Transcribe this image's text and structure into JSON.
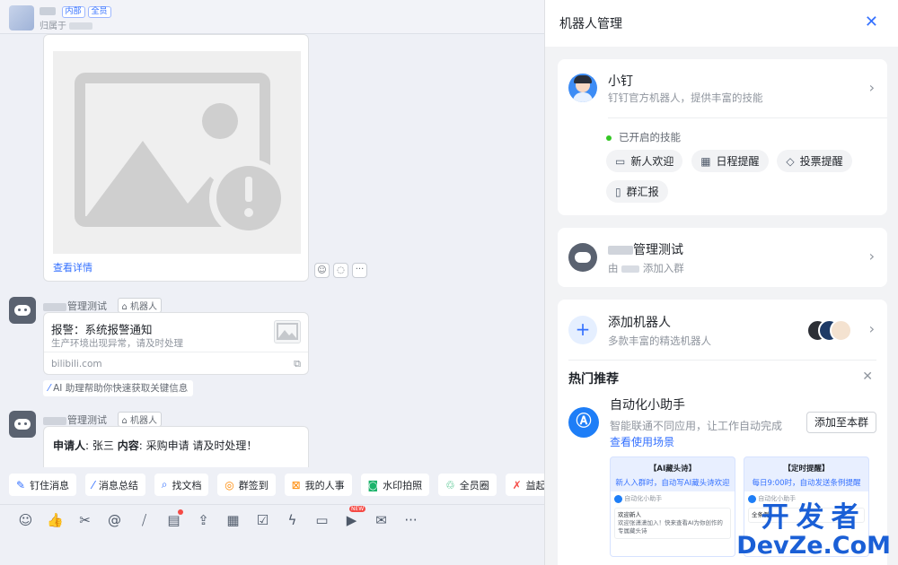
{
  "chat": {
    "header_tag1": "内部",
    "header_tag2": "全员",
    "header_sub": "归属于",
    "img_card": {
      "link": "查看详情"
    },
    "msg1": {
      "name_suffix": "管理测试",
      "robot_tag": "机器人",
      "title": "报警：系统报警通知",
      "desc": "生产环境出现异常，请及时处理",
      "source": "bilibili.com",
      "ai_hint": "AI 助理帮助你快速获取关键信息"
    },
    "msg2": {
      "name_suffix": "管理测试",
      "robot_tag": "机器人",
      "label1": "申请人",
      "val1": ": 张三 ",
      "label2": "内容",
      "val2": ": 采购申请 请及时处理！"
    },
    "quick_actions": [
      "钉住消息",
      "消息总结",
      "找文档",
      "群签到",
      "我的人事",
      "水印拍照",
      "全员圈",
      "益起动"
    ],
    "toolbar_new_badge": "NEW"
  },
  "panel": {
    "title": "机器人管理",
    "bot1": {
      "name": "小钉",
      "desc": "钉钉官方机器人，提供丰富的技能",
      "enabled_label": "已开启的技能",
      "skills": [
        "新人欢迎",
        "日程提醒",
        "投票提醒",
        "群汇报"
      ]
    },
    "bot2": {
      "name_suffix": "管理测试",
      "by_prefix": "由",
      "by_suffix": "添加入群"
    },
    "add": {
      "title": "添加机器人",
      "desc": "多款丰富的精选机器人"
    },
    "hot": {
      "title": "热门推荐",
      "item_title": "自动化小助手",
      "item_desc": "智能联通不同应用，让工作自动完成",
      "item_link": "查看使用场景",
      "add_button": "添加至本群",
      "thumb1": {
        "t1": "【AI藏头诗】",
        "t2": "新人入群时，自动写AI藏头诗欢迎",
        "app": "自动化小助手",
        "welcome": "欢迎新人",
        "text": "欢迎张潇潇加入！快来查看AI为你创作的专属藏头诗"
      },
      "thumb2": {
        "t1": "【定时提醒】",
        "t2": "每日9:00时，自动发送条例提醒",
        "app": "自动化小助手",
        "text": "全条例"
      }
    }
  },
  "watermark": {
    "line1": "开发者",
    "line2": "DevZe.CoM"
  },
  "colors": {
    "accent": "#3370ff",
    "status_green": "#34c724"
  }
}
